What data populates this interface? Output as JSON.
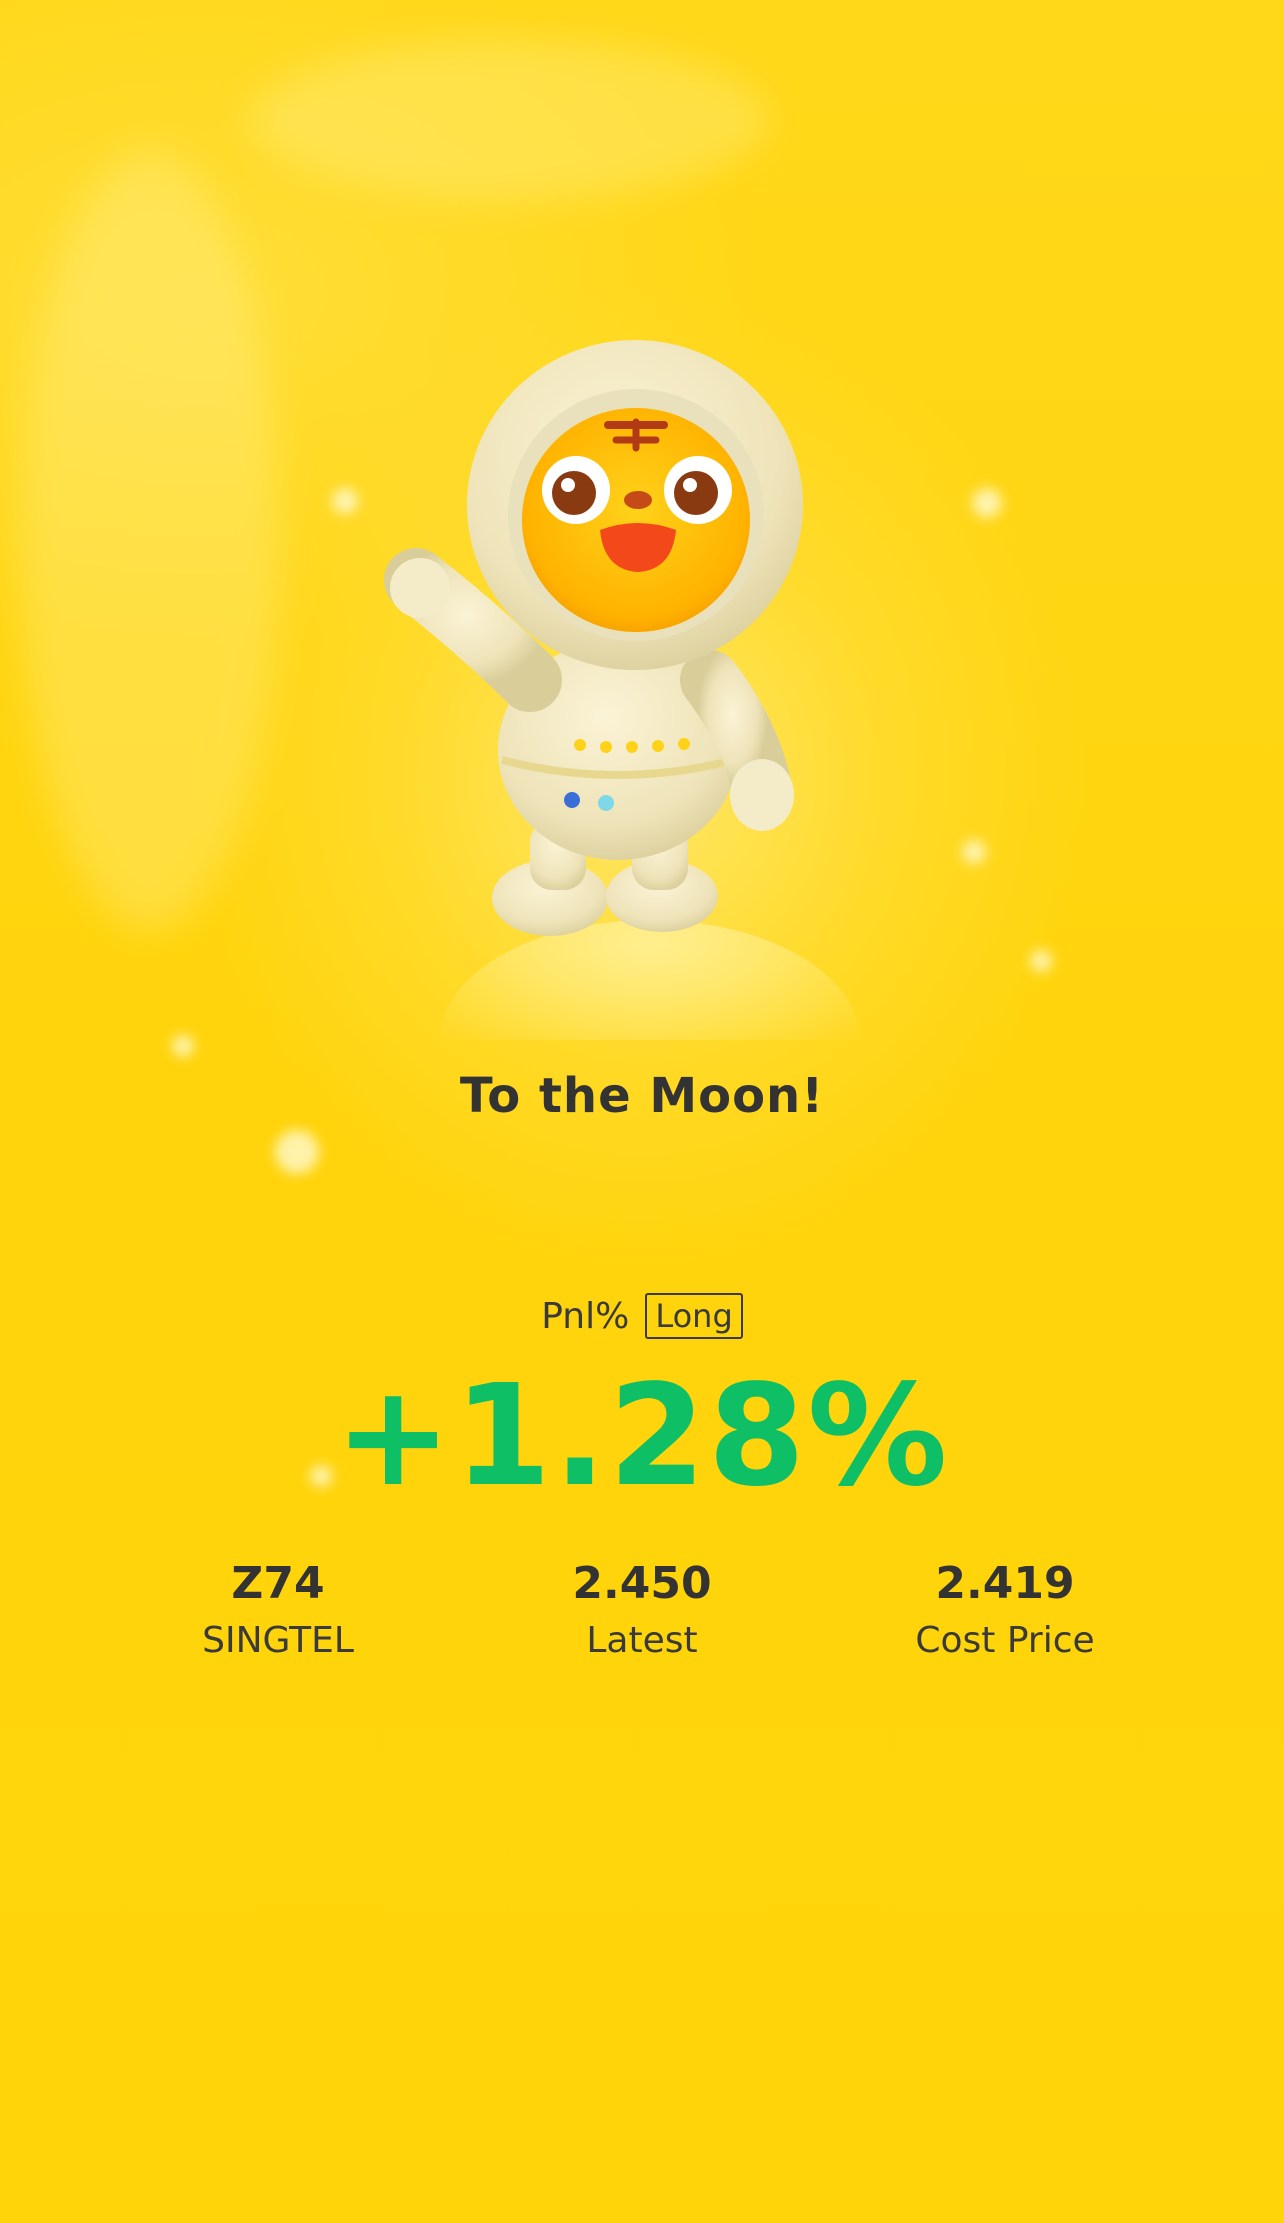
{
  "title": "To the Moon!",
  "pnl": {
    "label": "Pnl%",
    "position_tag": "Long",
    "value": "+1.28%"
  },
  "stats": [
    {
      "value": "Z74",
      "label": "SINGTEL"
    },
    {
      "value": "2.450",
      "label": "Latest"
    },
    {
      "value": "2.419",
      "label": "Cost Price"
    }
  ],
  "colors": {
    "background": "#FFD60A",
    "gain": "#0FBF66",
    "text": "#333333"
  },
  "icons": {
    "mascot": "tiger-astronaut-mascot-icon"
  }
}
